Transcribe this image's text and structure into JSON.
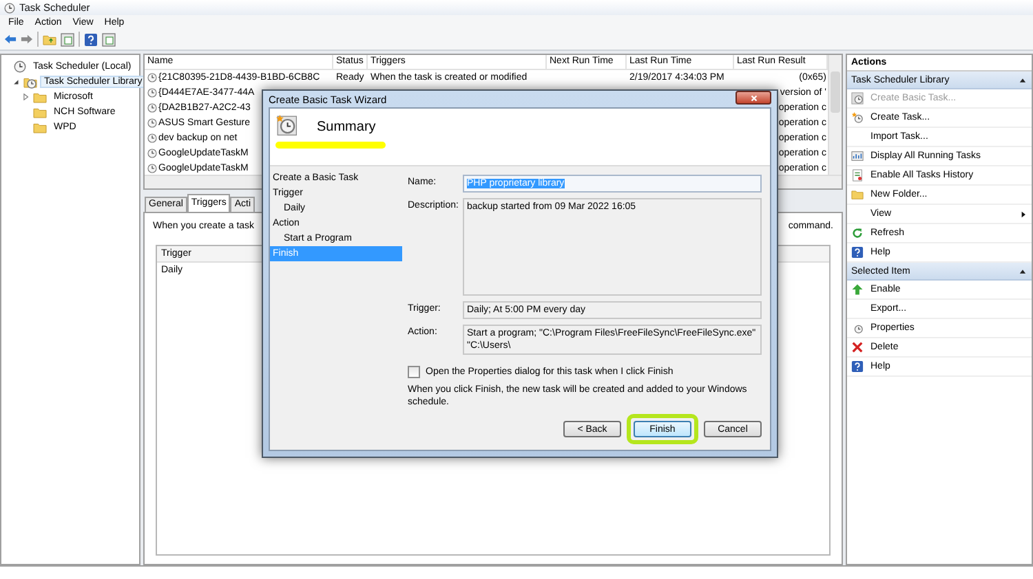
{
  "window": {
    "title": "Task Scheduler"
  },
  "menu": [
    "File",
    "Action",
    "View",
    "Help"
  ],
  "tree": [
    {
      "label": "Task Scheduler (Local)",
      "selected": false,
      "children": [
        {
          "label": "Task Scheduler Library",
          "selected": true,
          "expanded": true,
          "children": [
            {
              "label": "Microsoft",
              "selected": false,
              "expanded": false
            },
            {
              "label": "NCH Software",
              "selected": false
            },
            {
              "label": "WPD",
              "selected": false
            }
          ]
        }
      ]
    }
  ],
  "tasks": {
    "columns": [
      "Name",
      "Status",
      "Triggers",
      "Next Run Time",
      "Last Run Time",
      "Last Run Result"
    ],
    "rows": [
      {
        "name": "{21C80395-21D8-4439-B1BD-6CB8C",
        "status": "Ready",
        "triggers": "When the task is created or modified",
        "last_run_time": "2/19/2017 4:34:03 PM",
        "last_run_result": "(0x65)"
      },
      {
        "name": "{D444E7AE-3477-44A",
        "last_run_result": "version of '"
      },
      {
        "name": "{DA2B1B27-A2C2-43",
        "last_run_result": "operation c"
      },
      {
        "name": "ASUS Smart Gesture",
        "last_run_result": "operation c"
      },
      {
        "name": "dev backup on net",
        "last_run_result": "operation c"
      },
      {
        "name": "GoogleUpdateTaskM",
        "last_run_result": "operation c"
      },
      {
        "name": "GoogleUpdateTaskM",
        "last_run_result": "operation c"
      }
    ]
  },
  "detail": {
    "tabs": [
      {
        "label": "General",
        "selected": false
      },
      {
        "label": "Triggers",
        "selected": true
      },
      {
        "label": "Acti",
        "selected": false
      }
    ],
    "intro_start": "When you create a task",
    "intro_end": "command.",
    "trigger_table": {
      "columns": [
        "Trigger"
      ],
      "rows": [
        [
          "Daily"
        ]
      ]
    }
  },
  "actions": {
    "title": "Actions",
    "sections": [
      {
        "title": "Task Scheduler Library",
        "expanded": true,
        "items": [
          {
            "label": "Create Basic Task...",
            "disabled": true,
            "submenu": false
          },
          {
            "label": "Create Task...",
            "disabled": false,
            "submenu": false
          },
          {
            "label": "Import Task...",
            "disabled": false,
            "submenu": false
          },
          {
            "label": "Display All Running Tasks",
            "disabled": false,
            "submenu": false
          },
          {
            "label": "Enable All Tasks History",
            "disabled": false,
            "submenu": false
          },
          {
            "label": "New Folder...",
            "disabled": false,
            "submenu": false
          },
          {
            "label": "View",
            "disabled": false,
            "submenu": true
          },
          {
            "label": "Refresh",
            "disabled": false,
            "submenu": false
          },
          {
            "label": "Help",
            "disabled": false,
            "submenu": false
          }
        ]
      },
      {
        "title": "Selected Item",
        "expanded": true,
        "items": [
          {
            "label": "Enable",
            "disabled": false,
            "submenu": false
          },
          {
            "label": "Export...",
            "disabled": false,
            "submenu": false
          },
          {
            "label": "Properties",
            "disabled": false,
            "submenu": false
          },
          {
            "label": "Delete",
            "disabled": false,
            "submenu": false
          },
          {
            "label": "Help",
            "disabled": false,
            "submenu": false
          }
        ]
      }
    ]
  },
  "wizard": {
    "title": "Create Basic Task Wizard",
    "heading": "Summary",
    "heading_highlighted": true,
    "steps": [
      {
        "label": "Create a Basic Task",
        "selected": false
      },
      {
        "label": "Trigger",
        "selected": false,
        "children": [
          {
            "label": "Daily",
            "selected": false
          }
        ]
      },
      {
        "label": "Action",
        "selected": false,
        "children": [
          {
            "label": "Start a Program",
            "selected": false
          }
        ]
      },
      {
        "label": "Finish",
        "selected": true
      }
    ],
    "fields": [
      {
        "label": "Name:",
        "value": "PHP proprietary library",
        "kind": "text",
        "text_selected": true
      },
      {
        "label": "Description:",
        "value": "backup started from 09 Mar 2022 16:05",
        "kind": "multiline"
      },
      {
        "label": "Trigger:",
        "value": "Daily; At 5:00 PM every day",
        "kind": "readonly"
      },
      {
        "label": "Action:",
        "value": "Start a program; \"C:\\Program Files\\FreeFileSync\\FreeFileSync.exe\" \"C:\\Users\\",
        "kind": "readonly"
      }
    ],
    "open_properties": {
      "label": "Open the Properties dialog for this task when I click Finish",
      "checked": false
    },
    "note": "When you click Finish, the new task will be created and added to your Windows schedule.",
    "buttons": [
      {
        "label": "< Back",
        "default": false,
        "highlighted": false
      },
      {
        "label": "Finish",
        "default": true,
        "highlighted": true
      },
      {
        "label": "Cancel",
        "default": false,
        "highlighted": false
      }
    ]
  }
}
